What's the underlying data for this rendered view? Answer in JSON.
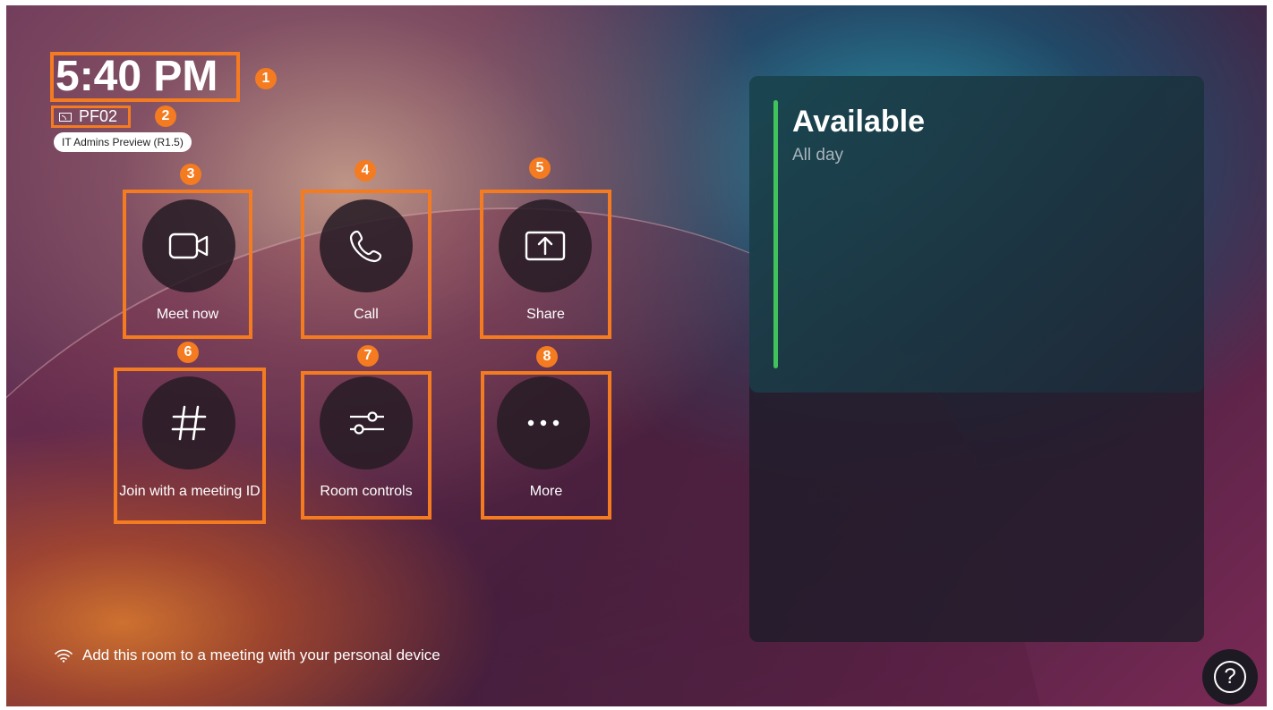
{
  "header": {
    "time": "5:40 PM",
    "room_name": "PF02",
    "version_badge": "IT Admins Preview (R1.5)"
  },
  "callouts": [
    "1",
    "2",
    "3",
    "4",
    "5",
    "6",
    "7",
    "8"
  ],
  "actions": [
    {
      "label": "Meet now",
      "icon": "video-camera-icon"
    },
    {
      "label": "Call",
      "icon": "phone-icon"
    },
    {
      "label": "Share",
      "icon": "share-screen-icon"
    },
    {
      "label": "Join with a meeting ID",
      "icon": "hashtag-icon"
    },
    {
      "label": "Room controls",
      "icon": "sliders-icon"
    },
    {
      "label": "More",
      "icon": "more-dots-icon"
    }
  ],
  "calendar": {
    "status": "Available",
    "subtitle": "All day",
    "status_color": "#3fc35a"
  },
  "footer": {
    "proximity_text": "Add this room to a meeting with your personal device",
    "help_symbol": "?"
  },
  "colors": {
    "callout": "#f47b20",
    "tile_circle": "#281c26"
  }
}
